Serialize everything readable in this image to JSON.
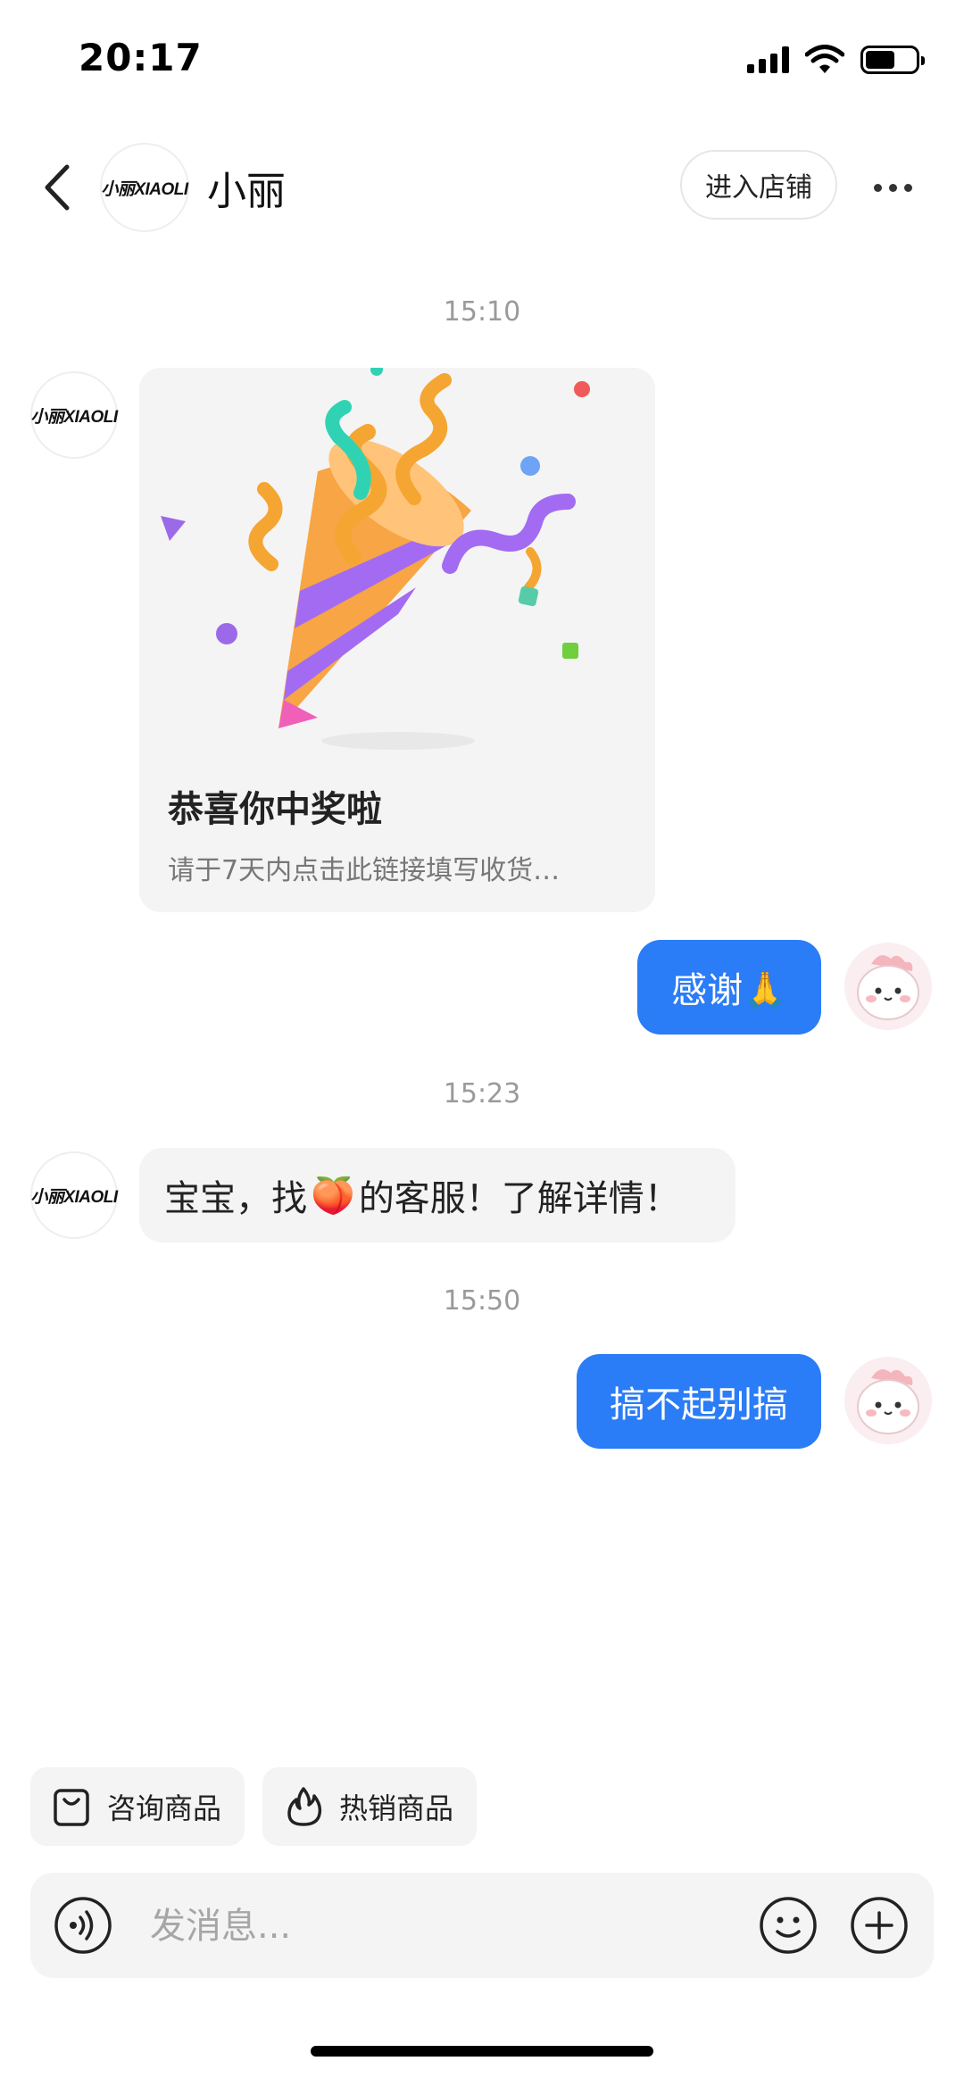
{
  "status_bar": {
    "time": "20:17",
    "battery_level": 0.6
  },
  "header": {
    "contact_name": "小丽",
    "logo_text": "小丽XIAOLI",
    "enter_shop_label": "进入店铺"
  },
  "messages": {
    "ts1": "15:10",
    "card": {
      "title": "恭喜你中奖啦",
      "desc": "请于7天内点击此链接填写收货…"
    },
    "reply1": "感谢🙏",
    "ts2": "15:23",
    "msg2_before": "宝宝，找",
    "msg2_emoji": "🍑",
    "msg2_after": "的客服！了解详情！",
    "ts3": "15:50",
    "reply2": "搞不起别搞"
  },
  "quick_actions": [
    {
      "label": "咨询商品",
      "icon": "shopping-bag-icon"
    },
    {
      "label": "热销商品",
      "icon": "flame-icon"
    }
  ],
  "input": {
    "placeholder": "发消息..."
  },
  "colors": {
    "accent": "#2a7cf7",
    "bubble_gray": "#f4f4f4"
  }
}
